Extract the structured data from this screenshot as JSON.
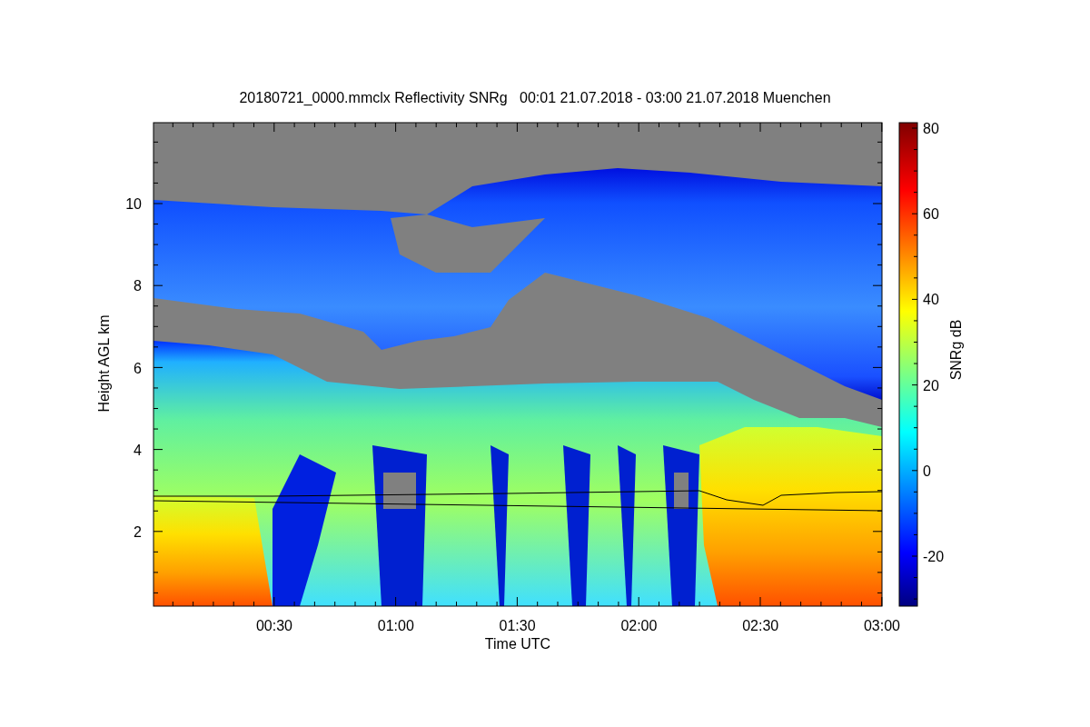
{
  "plot": {
    "title": "20180721_0000.mmclx Reflectivity SNRg   00:01 21.07.2018 - 03:00 21.07.2018 Muenchen",
    "xlabel": "Time UTC",
    "ylabel": "Height AGL km",
    "xticks": [
      "00:30",
      "01:00",
      "01:30",
      "02:00",
      "02:30",
      "03:00"
    ],
    "yticks": [
      "10",
      "8",
      "6",
      "4",
      "2"
    ]
  },
  "colorbar": {
    "label": "SNRg dB",
    "ticks": [
      "80",
      "60",
      "40",
      "20",
      "0",
      "-20"
    ]
  }
}
